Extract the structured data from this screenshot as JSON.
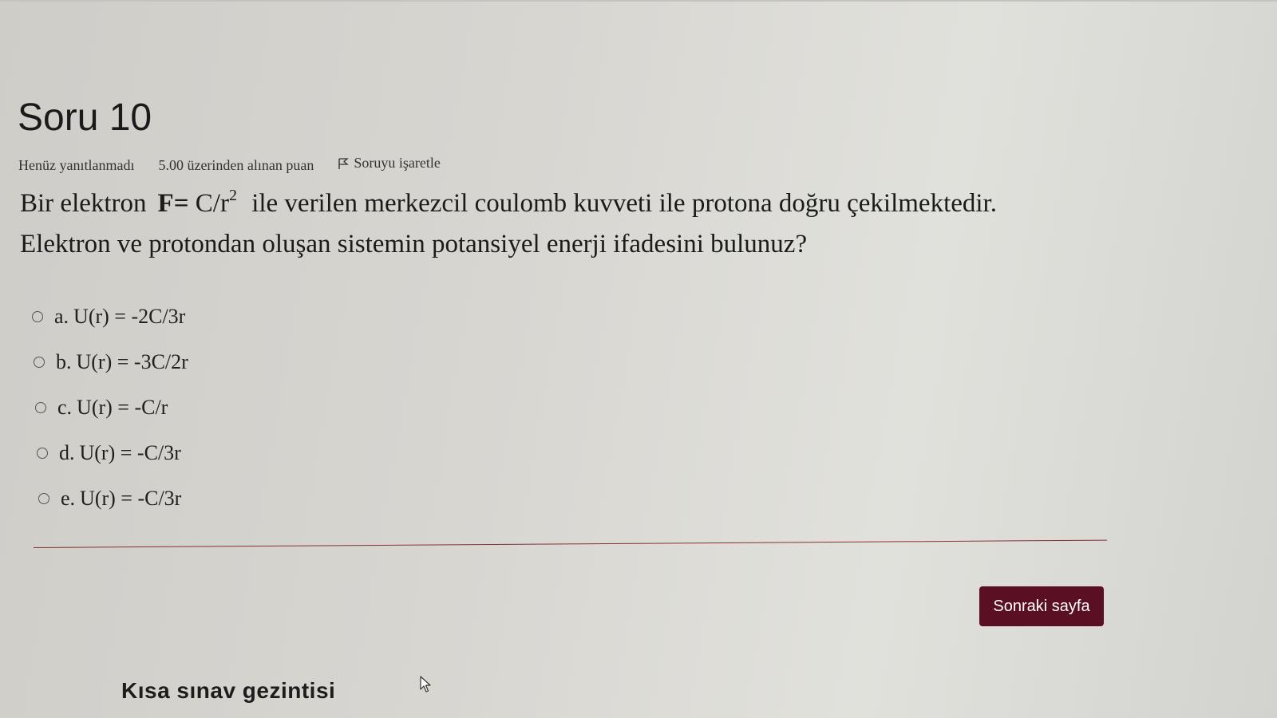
{
  "question": {
    "title": "Soru 10",
    "status": "Henüz yanıtlanmadı",
    "points": "5.00 üzerinden alınan puan",
    "flag_label": "Soruyu işaretle",
    "text_before": "Bir elektron",
    "formula_main": "F=",
    "formula_rest": "C/r",
    "formula_exp": "2",
    "text_after_line1": "ile verilen merkezcil coulomb kuvveti ile protona doğru çekilmektedir.",
    "text_line2": "Elektron ve protondan oluşan sistemin potansiyel enerji ifadesini bulunuz?"
  },
  "answers": [
    {
      "letter": "a.",
      "text": "U(r) = -2C/3r"
    },
    {
      "letter": "b.",
      "text": "U(r) = -3C/2r"
    },
    {
      "letter": "c.",
      "text": "U(r) = -C/r"
    },
    {
      "letter": "d.",
      "text": "U(r) = -C/3r"
    },
    {
      "letter": "e.",
      "text": "U(r) = -C/3r"
    }
  ],
  "navigation": {
    "next_label": "Sonraki sayfa",
    "quiz_nav_title": "Kısa sınav gezintisi"
  },
  "icons": {
    "flag": "flag-icon",
    "radio": "radio-icon",
    "cursor": "mouse-pointer-icon"
  },
  "colors": {
    "next_button_bg": "#5b0f22",
    "divider": "#8a3030"
  }
}
